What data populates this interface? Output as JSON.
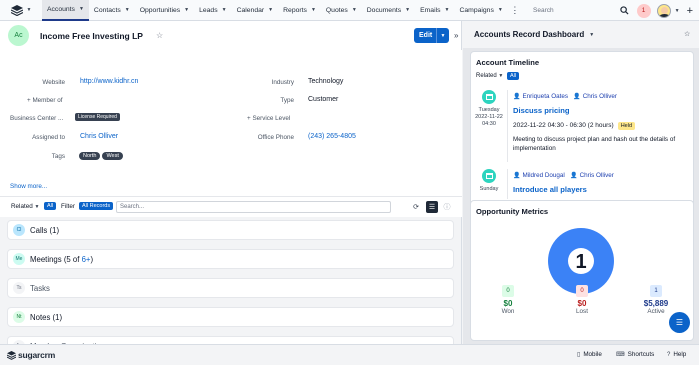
{
  "nav": {
    "tabs": [
      {
        "label": "Accounts",
        "active": true
      },
      {
        "label": "Contacts"
      },
      {
        "label": "Opportunities"
      },
      {
        "label": "Leads"
      },
      {
        "label": "Calendar"
      },
      {
        "label": "Reports"
      },
      {
        "label": "Quotes"
      },
      {
        "label": "Documents"
      },
      {
        "label": "Emails"
      },
      {
        "label": "Campaigns"
      }
    ],
    "search_placeholder": "Search",
    "notification_count": "1"
  },
  "record": {
    "avatar_initials": "Ac",
    "name": "Income Free Investing LP",
    "edit_label": "Edit",
    "fields": {
      "website_label": "Website",
      "website_value": "http://www.kidhr.cn",
      "industry_label": "Industry",
      "industry_value": "Technology",
      "member_of_label": "Member of",
      "type_label": "Type",
      "type_value": "Customer",
      "business_center_label": "Business Center ...",
      "license_badge": "License Required",
      "service_level_label": "Service Level",
      "assigned_label": "Assigned to",
      "assigned_value": "Chris Olliver",
      "office_phone_label": "Office Phone",
      "office_phone_value": "(243) 265-4805",
      "tags_label": "Tags",
      "tags": [
        "North",
        "West"
      ]
    },
    "show_more": "Show more..."
  },
  "subpanel_toolbar": {
    "related_label": "Related",
    "all_pill": "All",
    "filter_label": "Filter",
    "all_records_pill": "All Records",
    "search_placeholder": "Search..."
  },
  "subpanels": [
    {
      "abbr": "Cl",
      "name": "Calls",
      "count": "(1)",
      "color": "#bae6fd",
      "text": "#0369a1"
    },
    {
      "abbr": "Me",
      "name": "Meetings",
      "count_prefix": "(5 of ",
      "count_link": "6+",
      "count_suffix": ")",
      "color": "#ccfbf1",
      "text": "#0f766e"
    },
    {
      "abbr": "Ts",
      "name": "Tasks",
      "color": "#f3f4f6",
      "text": "#6b7280"
    },
    {
      "abbr": "Nt",
      "name": "Notes",
      "count": "(1)",
      "color": "#dcfce7",
      "text": "#15803d"
    },
    {
      "abbr": "Ac",
      "name": "Member Organizations",
      "color": "#f3f4f6",
      "text": "#6b7280"
    }
  ],
  "dashboard": {
    "title": "Accounts Record Dashboard",
    "timeline": {
      "title": "Account Timeline",
      "related_label": "Related",
      "all_pill": "All",
      "entries": [
        {
          "day": "Tuesday",
          "date": "2022-11-22",
          "time": "04:30",
          "people": [
            "Enriqueta Oates",
            "Chris Olliver"
          ],
          "subject": "Discuss pricing",
          "when": "2022-11-22 04:30 - 06:30 (2 hours)",
          "status": "Held",
          "description": "Meeting to discuss project plan and hash out the details of implementation"
        },
        {
          "day": "Sunday",
          "people": [
            "Mildred Dougal",
            "Chris Olliver"
          ],
          "subject": "Introduce all players"
        }
      ]
    },
    "metrics": {
      "title": "Opportunity Metrics",
      "total": "1",
      "items": [
        {
          "count": "0",
          "value": "$0",
          "label": "Won",
          "color": "#15803d",
          "bg": "#dcfce7"
        },
        {
          "count": "0",
          "value": "$0",
          "label": "Lost",
          "color": "#b91c1c",
          "bg": "#fee2e2"
        },
        {
          "count": "1",
          "value": "$5,889",
          "label": "Active",
          "color": "#1e3a8a",
          "bg": "#dbeafe"
        }
      ],
      "accent": "#3b82f6"
    }
  },
  "footer": {
    "logo": "sugarcrm",
    "mobile": "Mobile",
    "shortcuts": "Shortcuts",
    "help": "Help"
  },
  "colors": {
    "primary": "#0b63c9",
    "nav_active_bar": "#1e3a8a"
  }
}
